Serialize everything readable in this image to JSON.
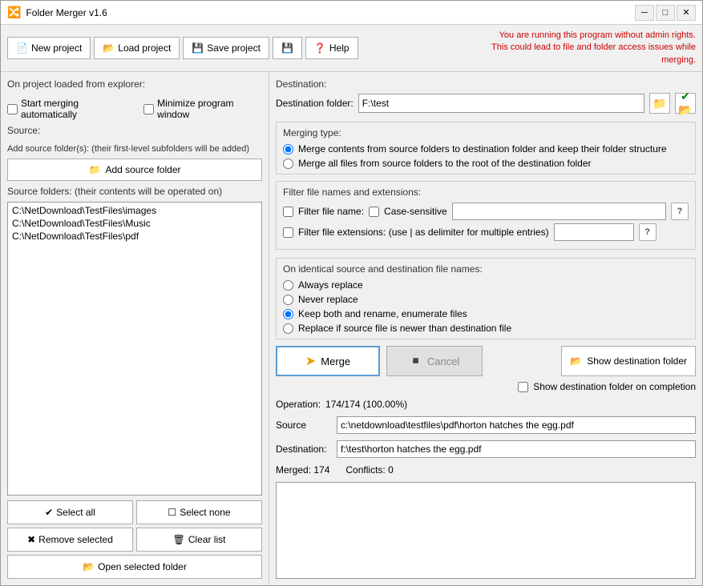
{
  "window": {
    "title": "Folder Merger v1.6",
    "min_label": "─",
    "max_label": "□",
    "close_label": "✕"
  },
  "toolbar": {
    "new_project": "New project",
    "load_project": "Load project",
    "save_project": "Save project",
    "save_icon": "💾",
    "help": "Help",
    "help_icon": "?",
    "alert_line1": "You are running this program without admin rights.",
    "alert_line2": "This could lead to file and folder access issues while merging."
  },
  "left": {
    "on_project_label": "On project loaded from explorer:",
    "start_merging_label": "Start merging automatically",
    "minimize_label": "Minimize program window",
    "source_label": "Source:",
    "add_source_desc": "(their first-level subfolders will be added)",
    "add_source_btn": "Add source folder",
    "source_folders_label": "Source folders: (their contents will be operated on)",
    "source_items": [
      "C:\\NetDownload\\TestFiles\\images",
      "C:\\NetDownload\\TestFiles\\Music",
      "C:\\NetDownload\\TestFiles\\pdf"
    ],
    "select_all": "Select all",
    "select_none": "Select none",
    "remove_selected": "Remove selected",
    "clear_list": "Clear list",
    "open_selected": "Open selected folder"
  },
  "right": {
    "destination_label": "Destination:",
    "dest_folder_label": "Destination folder:",
    "dest_folder_value": "F:\\test",
    "merging_type_label": "Merging type:",
    "merge_opt1": "Merge contents from source folders to destination folder and keep their folder structure",
    "merge_opt2": "Merge all files from source folders to the root of the destination folder",
    "filter_label": "Filter file names and extensions:",
    "filter_name_label": "Filter file name:",
    "case_sensitive_label": "Case-sensitive",
    "filter_ext_label": "Filter file extensions: (use | as delimiter for multiple entries)",
    "identical_label": "On identical source and destination file names:",
    "always_replace": "Always replace",
    "never_replace": "Never replace",
    "keep_both": "Keep both and rename, enumerate files",
    "replace_newer": "Replace if source file is newer than destination file",
    "merge_btn": "Merge",
    "cancel_btn": "Cancel",
    "show_dest_btn": "Show destination folder",
    "show_dest_on_completion": "Show destination folder on completion",
    "operation_label": "Operation:",
    "operation_value": "174/174 (100.00%)",
    "source_label": "Source",
    "source_value": "c:\\netdownload\\testfiles\\pdf\\horton hatches the egg.pdf",
    "destination_label2": "Destination:",
    "destination_value": "f:\\test\\horton hatches the egg.pdf",
    "merged_label": "Merged: 174",
    "conflicts_label": "Conflicts: 0"
  },
  "icons": {
    "folder": "📁",
    "folder_open": "📂",
    "save": "💾",
    "question": "?",
    "merge_arrow": "➤",
    "check_green": "✔",
    "new_doc": "📄",
    "load": "📂"
  }
}
